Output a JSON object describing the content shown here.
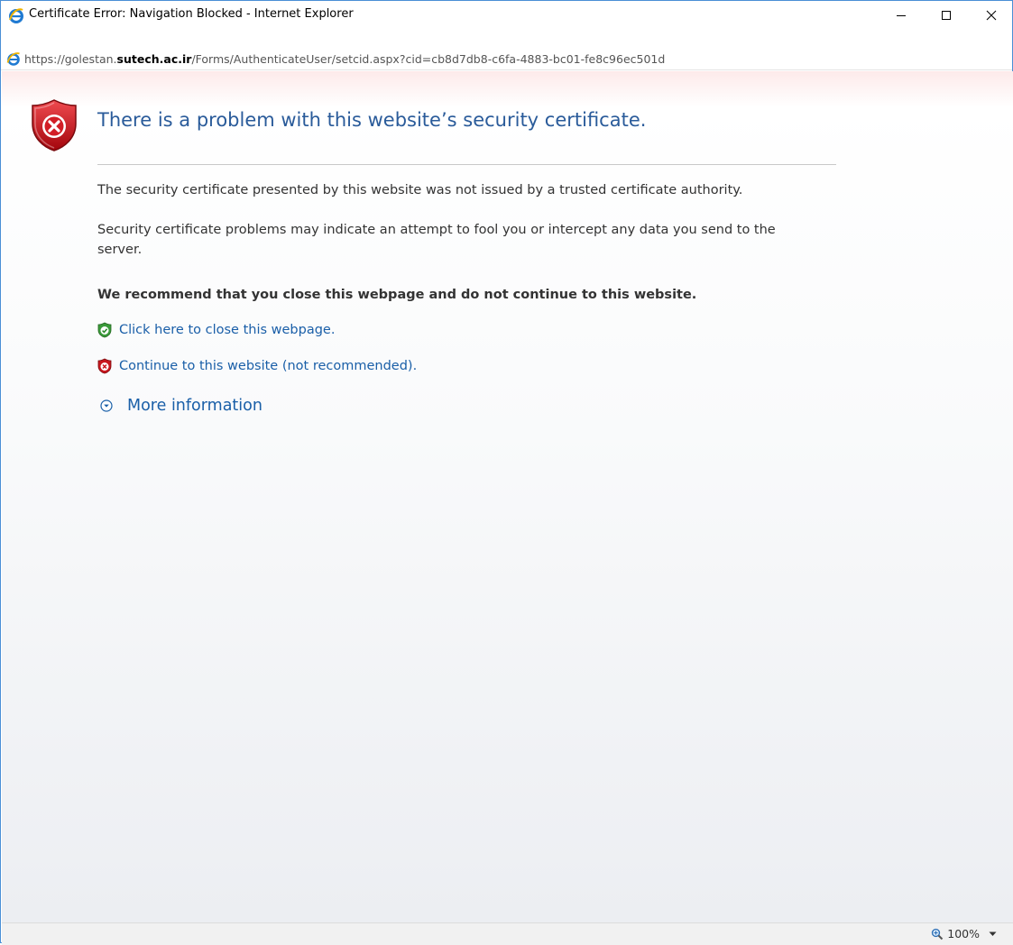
{
  "window": {
    "title": "Certificate Error: Navigation Blocked - Internet Explorer",
    "icon": "ie-icon",
    "controls": [
      "minimize-icon",
      "maximize-icon",
      "close-icon"
    ]
  },
  "address": {
    "url_prefix": "https://golestan.",
    "url_domain": "sutech.ac.ir",
    "url_path": "/Forms/AuthenticateUser/setcid.aspx?cid=cb8d7db8-c6fa-4883-bc01-fe8c96ec501d"
  },
  "page": {
    "headline": "There is a problem with this website’s security certificate.",
    "p1": "The security certificate presented by this website was not issued by a trusted certificate authority.",
    "p2": "Security certificate problems may indicate an attempt to fool you or intercept any data you send to the server.",
    "recommend": "We recommend that you close this webpage and do not continue to this website.",
    "close_link": "Click here to close this webpage.",
    "continue_link": "Continue to this website (not recommended).",
    "more_info": "More information"
  },
  "status": {
    "zoom": "100%"
  },
  "colors": {
    "headline": "#2a5b9a",
    "link": "#1a5fa8",
    "shield_red": "#c8171e",
    "shield_green": "#3a9a3a",
    "window_border": "#4a8fd6"
  }
}
